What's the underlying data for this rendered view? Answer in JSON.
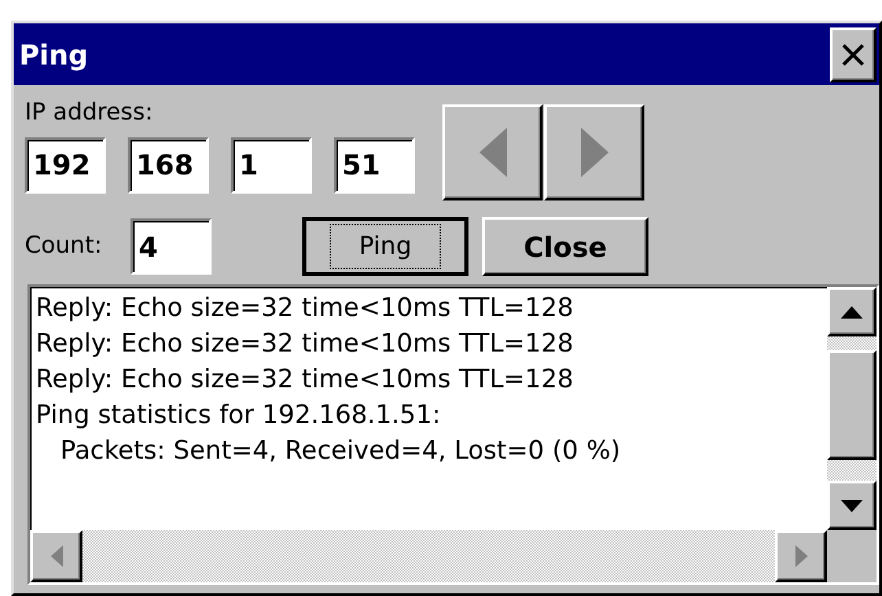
{
  "window": {
    "title": "Ping"
  },
  "ip_address": {
    "label": "IP address:",
    "octets": [
      "192",
      "168",
      "1",
      "51"
    ]
  },
  "nav_buttons": [
    {
      "kind": "left",
      "disabled": true
    },
    {
      "kind": "right",
      "disabled": true
    }
  ],
  "count": {
    "label": "Count:",
    "value": "4"
  },
  "buttons": [
    {
      "label": "Ping",
      "bold": false,
      "focused": true
    },
    {
      "label": "Close",
      "bold": true,
      "focused": false
    }
  ],
  "output": {
    "lines": [
      {
        "text": "Reply: Echo size=32 time<10ms TTL=128",
        "indented": false
      },
      {
        "text": "Reply: Echo size=32 time<10ms TTL=128",
        "indented": false
      },
      {
        "text": "Reply: Echo size=32 time<10ms TTL=128",
        "indented": false
      },
      {
        "text": "Ping statistics for 192.168.1.51:",
        "indented": false
      },
      {
        "text": "Packets: Sent=4, Received=4, Lost=0 (0 %)",
        "indented": true
      }
    ]
  }
}
